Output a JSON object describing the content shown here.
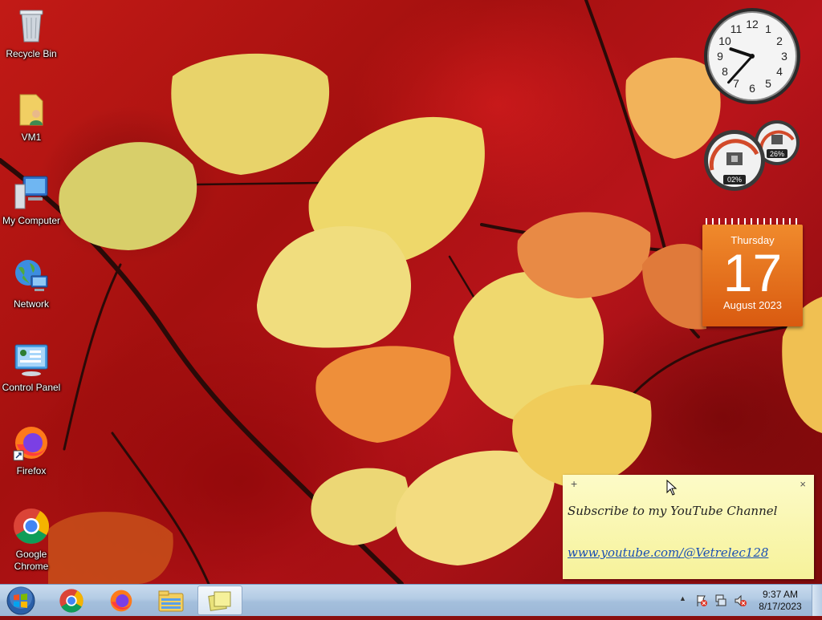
{
  "desktop": {
    "icons": [
      {
        "label": "Recycle Bin",
        "icon": "recycle-bin-icon"
      },
      {
        "label": "VM1",
        "icon": "user-folder-icon"
      },
      {
        "label": "My Computer",
        "icon": "computer-icon"
      },
      {
        "label": "Network",
        "icon": "network-icon"
      },
      {
        "label": "Control Panel",
        "icon": "control-panel-icon"
      },
      {
        "label": "Firefox",
        "icon": "firefox-icon"
      },
      {
        "label": "Google Chrome",
        "icon": "chrome-icon"
      }
    ]
  },
  "gadgets": {
    "clock": {
      "hour": 9,
      "minute": 37
    },
    "meter": {
      "cpu": "02%",
      "memory": "26%"
    },
    "calendar": {
      "weekday": "Thursday",
      "day": "17",
      "month_year": "August 2023",
      "color": "#e46d1c"
    }
  },
  "sticky_note": {
    "text_line1": "Subscribe to my YouTube Channel",
    "text_line2": "www.youtube.com/@Vetrelec128",
    "add_symbol": "+",
    "close_symbol": "×"
  },
  "taskbar": {
    "pinned": [
      "chrome-icon",
      "firefox-icon",
      "file-explorer-icon",
      "sticky-notes-icon"
    ],
    "active": "sticky-notes-icon",
    "tray": {
      "overflow_symbol": "▲",
      "time": "9:37 AM",
      "date": "8/17/2023"
    }
  },
  "colors": {
    "taskbar": "#b3cbe4",
    "note": "#f8f5a8",
    "link": "#1a4fb3"
  }
}
